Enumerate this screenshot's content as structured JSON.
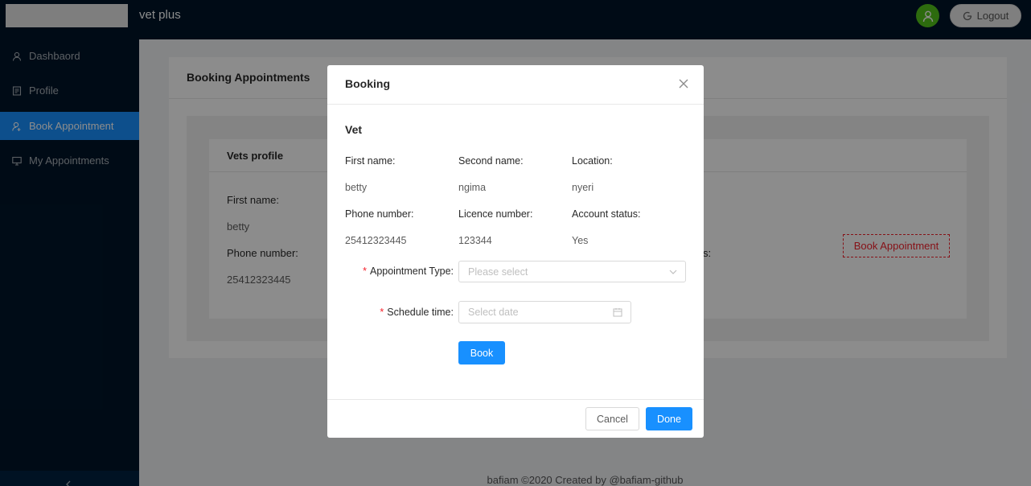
{
  "header": {
    "app_title": "vet plus",
    "logout_label": "Logout"
  },
  "sidebar": {
    "items": [
      {
        "label": "Dashbaord",
        "icon": "user-icon"
      },
      {
        "label": "Profile",
        "icon": "profile-icon"
      },
      {
        "label": "Book Appointment",
        "icon": "user-add-icon",
        "active": true
      },
      {
        "label": "My Appointments",
        "icon": "desktop-icon"
      }
    ]
  },
  "page": {
    "title": "Booking Appointments",
    "vet_card": {
      "title": "Vets profile",
      "first_name_label": "First name",
      "first_name": "betty",
      "phone_label": "Phone number",
      "phone": "25412323445",
      "partial_colon": "s:",
      "book_button": "Book Appointment"
    },
    "footer": "bafiam ©2020 Created by @bafiam-github"
  },
  "modal": {
    "title": "Booking",
    "section_title": "Vet",
    "fields": {
      "first_name_label": "First name",
      "first_name": "betty",
      "second_name_label": "Second name",
      "second_name": "ngima",
      "location_label": "Location",
      "location": "nyeri",
      "phone_label": "Phone number",
      "phone": "25412323445",
      "licence_label": "Licence number",
      "licence": "123344",
      "status_label": "Account status",
      "status": "Yes"
    },
    "form": {
      "appointment_type_label": "Appointment Type",
      "appointment_type_placeholder": "Please select",
      "schedule_label": "Schedule time",
      "schedule_placeholder": "Select date",
      "book_label": "Book"
    },
    "cancel_label": "Cancel",
    "done_label": "Done"
  },
  "colors": {
    "primary": "#1890ff",
    "dark": "#001529",
    "danger": "#f5222d",
    "avatar": "#52c41a"
  }
}
